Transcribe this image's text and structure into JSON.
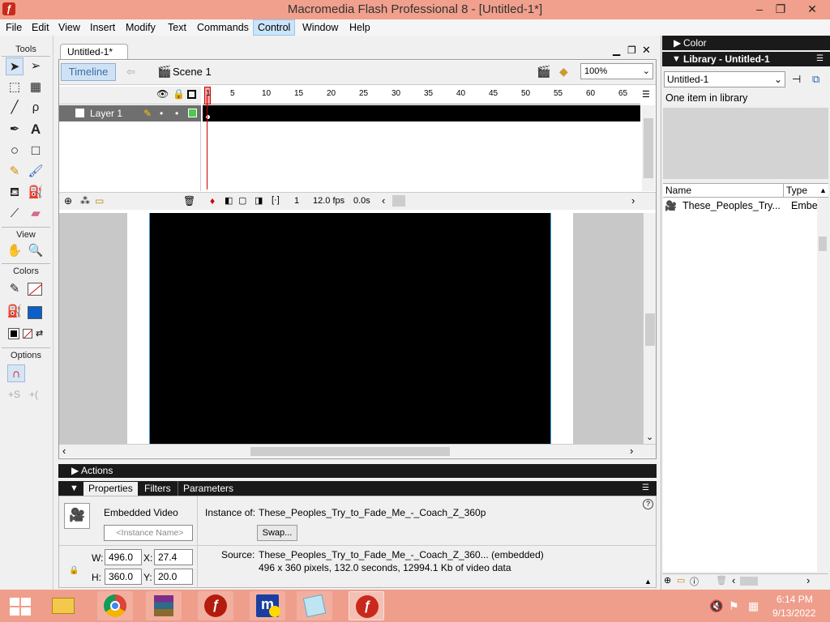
{
  "window": {
    "title": "Macromedia Flash Professional 8 - [Untitled-1*]",
    "minimize": "–",
    "restore": "❐",
    "close": "✕"
  },
  "menu": [
    "File",
    "Edit",
    "View",
    "Insert",
    "Modify",
    "Text",
    "Commands",
    "Control",
    "Window",
    "Help"
  ],
  "menu_active": "Control",
  "tools": {
    "header": "Tools",
    "view_header": "View",
    "colors_header": "Colors",
    "options_header": "Options"
  },
  "document": {
    "tab": "Untitled-1*",
    "timeline_button": "Timeline",
    "scene": "Scene 1",
    "zoom": "100%"
  },
  "timeline": {
    "ruler_ticks": [
      "1",
      "5",
      "10",
      "15",
      "20",
      "25",
      "30",
      "35",
      "40",
      "45",
      "50",
      "55",
      "60",
      "65"
    ],
    "layer_name": "Layer 1",
    "current_frame": "1",
    "fps": "12.0 fps",
    "time": "0.0s"
  },
  "actions_label": "Actions",
  "properties": {
    "tabs": [
      "Properties",
      "Filters",
      "Parameters"
    ],
    "type": "Embedded Video",
    "instance_placeholder": "<Instance Name>",
    "instance_of_label": "Instance of:",
    "instance_of": "These_Peoples_Try_to_Fade_Me_-_Coach_Z_360p",
    "swap": "Swap...",
    "w_label": "W:",
    "w": "496.0",
    "h_label": "H:",
    "h": "360.0",
    "x_label": "X:",
    "x": "27.4",
    "y_label": "Y:",
    "y": "20.0",
    "source_label": "Source:",
    "source_line1": "These_Peoples_Try_to_Fade_Me_-_Coach_Z_360... (embedded)",
    "source_line2": "496 x 360 pixels, 132.0 seconds, 12994.1 Kb of video data"
  },
  "panels": {
    "color": "Color",
    "library": "Library - Untitled-1",
    "library_doc": "Untitled-1",
    "library_count": "One item in library",
    "col_name": "Name",
    "col_type": "Type",
    "item_name": "These_Peoples_Try...",
    "item_type": "Embe"
  },
  "taskbar": {
    "time": "6:14 PM",
    "date": "9/13/2022"
  }
}
